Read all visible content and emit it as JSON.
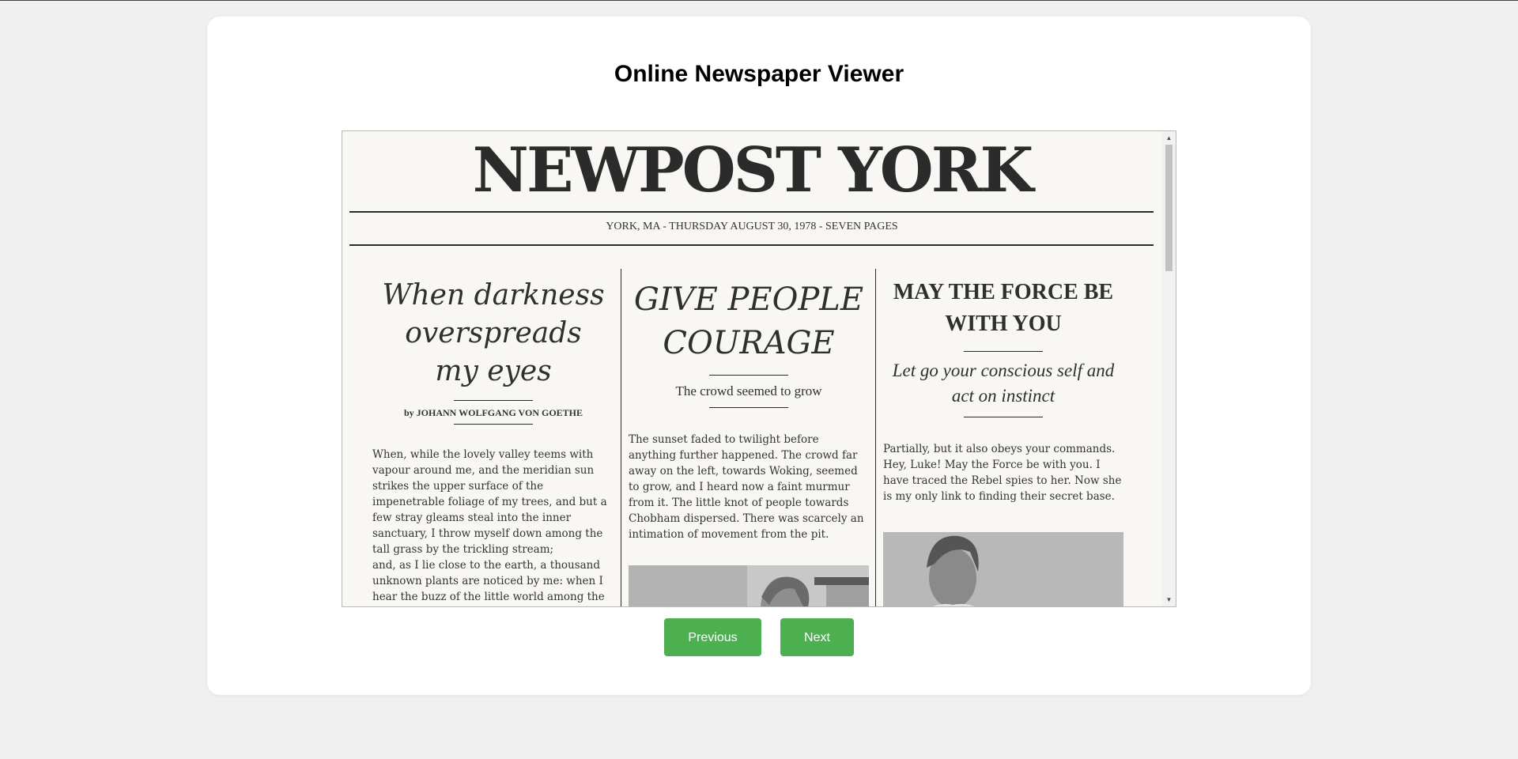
{
  "app": {
    "title": "Online Newspaper Viewer"
  },
  "newspaper": {
    "masthead": "NEWPOST YORK",
    "dateline": "YORK, MA - THURSDAY AUGUST 30, 1978 - SEVEN PAGES",
    "articles": [
      {
        "headline": "When darkness overspreads my eyes",
        "byline": "by JOHANN WOLFGANG VON GOETHE",
        "paragraphs": [
          "When, while the lovely valley teems with vapour around me, and the meridian sun strikes the upper surface of the impenetrable foliage of my trees, and but a few stray gleams steal into the inner sanctuary, I throw myself down among the tall grass by the trickling stream;",
          "and, as I lie close to the earth, a thousand unknown plants are noticed by me: when I hear the buzz of the little world among the"
        ]
      },
      {
        "headline": "GIVE PEOPLE COURAGE",
        "subhead": "The crowd seemed to grow",
        "paragraphs": [
          "The sunset faded to twilight before anything further happened. The crowd far away on the left, towards Woking, seemed to grow, and I heard now a faint murmur from it. The little knot of people towards Chobham dispersed. There was scarcely an intimation of movement from the pit."
        ]
      },
      {
        "headline": "MAY THE FORCE BE WITH YOU",
        "subhead": "Let go your conscious self and act on instinct",
        "paragraphs": [
          "Partially, but it also obeys your commands. Hey, Luke! May the Force be with you. I have traced the Rebel spies to her. Now she is my only link to finding their secret base."
        ]
      }
    ]
  },
  "controls": {
    "previous_label": "Previous",
    "next_label": "Next"
  },
  "colors": {
    "page_background": "#f0f0f0",
    "paper_background": "#f8f7f3",
    "button_green": "#4caf50",
    "ink": "#2b2b2b"
  }
}
